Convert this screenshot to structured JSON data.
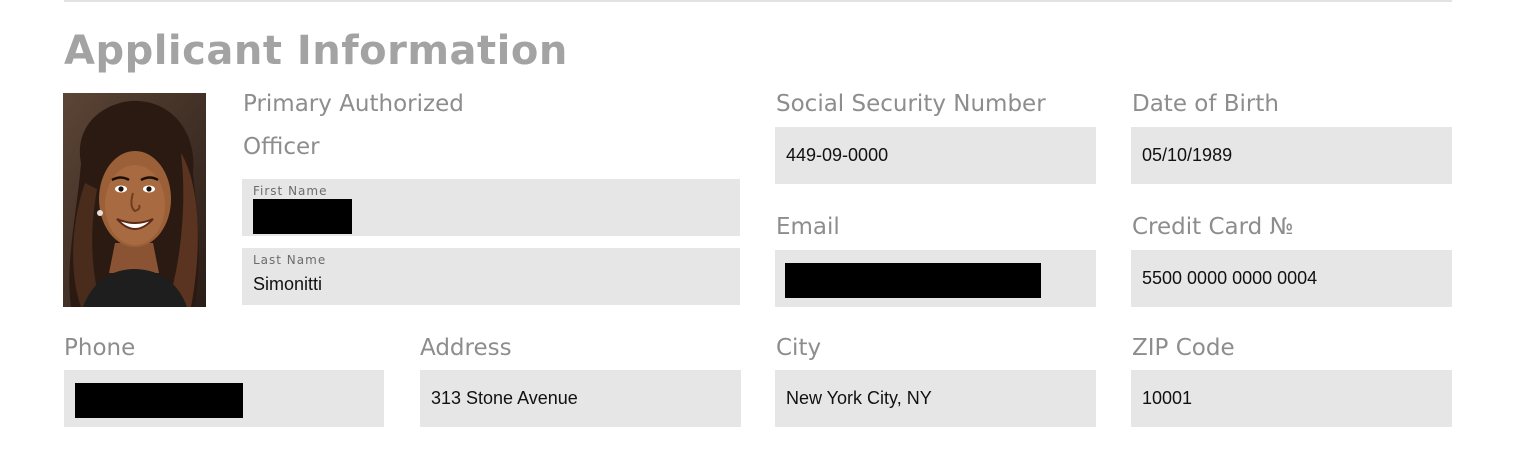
{
  "title": "Applicant Information",
  "officer": {
    "heading_line1": "Primary Authorized",
    "heading_line2": "Officer",
    "first_name_label": "First Name",
    "first_name_value": "",
    "last_name_label": "Last Name",
    "last_name_value": "Simonitti"
  },
  "ssn": {
    "label": "Social Security Number",
    "value": "449-09-0000"
  },
  "dob": {
    "label": "Date of Birth",
    "value": "05/10/1989"
  },
  "email": {
    "label": "Email",
    "value": ""
  },
  "credit_card": {
    "label": "Credit Card №",
    "value": "5500 0000 0000 0004"
  },
  "phone": {
    "label": "Phone",
    "value": ""
  },
  "address": {
    "label": "Address",
    "value": "313 Stone Avenue"
  },
  "city": {
    "label": "City",
    "value": "New York City, NY"
  },
  "zip": {
    "label": "ZIP Code",
    "value": "10001"
  },
  "colors": {
    "field_background": "#e6e6e7",
    "label_text": "#8d8d8d",
    "title_text": "#a3a3a3",
    "redaction": "#000000"
  }
}
